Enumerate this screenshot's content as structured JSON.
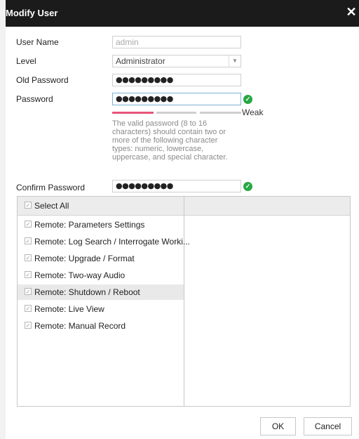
{
  "dialog": {
    "title": "Modify User",
    "close_label": "✕"
  },
  "form": {
    "user_name_label": "User Name",
    "user_name_value": "admin",
    "level_label": "Level",
    "level_value": "Administrator",
    "old_password_label": "Old Password",
    "old_password_value": "●●●●●●●●●",
    "password_label": "Password",
    "password_value": "●●●●●●●●●",
    "strength_label": "Weak",
    "hint": "The valid password (8 to 16 characters) should contain two or more of the following character types: numeric, lowercase, uppercase, and special character.",
    "confirm_password_label": "Confirm Password",
    "confirm_password_value": "●●●●●●●●●"
  },
  "permissions": {
    "select_all_label": "Select All",
    "items": [
      {
        "label": "Remote: Parameters Settings",
        "checked": true
      },
      {
        "label": "Remote: Log Search / Interrogate Worki...",
        "checked": true
      },
      {
        "label": "Remote: Upgrade / Format",
        "checked": true
      },
      {
        "label": "Remote: Two-way Audio",
        "checked": true
      },
      {
        "label": "Remote: Shutdown / Reboot",
        "checked": true
      },
      {
        "label": "Remote: Live View",
        "checked": true
      },
      {
        "label": "Remote: Manual Record",
        "checked": true
      }
    ]
  },
  "buttons": {
    "ok": "OK",
    "cancel": "Cancel"
  },
  "colors": {
    "strength_active": "#e8557a",
    "strength_inactive": "#cfcfcf",
    "valid_check": "#27a844",
    "titlebar": "#1b1b1b"
  }
}
